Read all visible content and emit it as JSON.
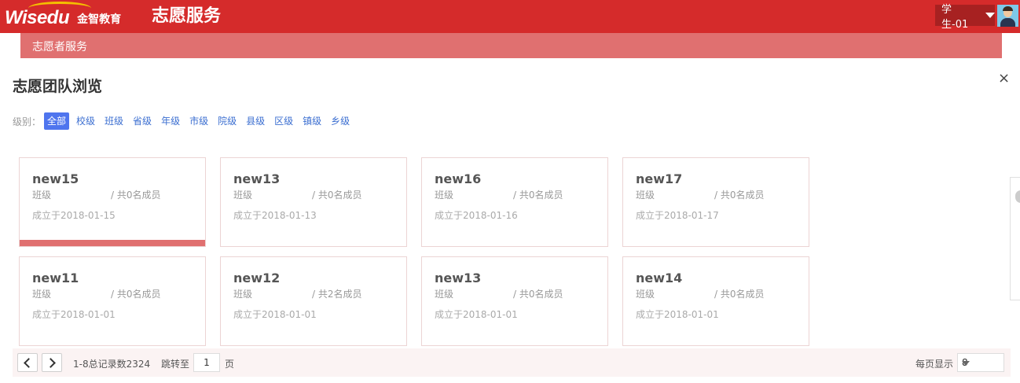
{
  "header": {
    "logo_en": "Wisedu",
    "logo_cn": "金智教育",
    "app_title": "志愿服务",
    "user_label": "学生-01"
  },
  "subnav": {
    "label": "志愿者服务"
  },
  "page": {
    "title": "志愿团队浏览",
    "close": "×"
  },
  "filter": {
    "label": "级别：",
    "levels": [
      "全部",
      "校级",
      "班级",
      "省级",
      "年级",
      "市级",
      "院级",
      "县级",
      "区级",
      "镇级",
      "乡级"
    ],
    "active": "全部"
  },
  "teams": [
    {
      "name": "new15",
      "type": "班级",
      "members": "/ 共0名成员",
      "date": "成立于2018-01-15"
    },
    {
      "name": "new13",
      "type": "班级",
      "members": "/ 共0名成员",
      "date": "成立于2018-01-13"
    },
    {
      "name": "new16",
      "type": "班级",
      "members": "/ 共0名成员",
      "date": "成立于2018-01-16"
    },
    {
      "name": "new17",
      "type": "班级",
      "members": "/ 共0名成员",
      "date": "成立于2018-01-17"
    },
    {
      "name": "new11",
      "type": "班级",
      "members": "/ 共0名成员",
      "date": "成立于2018-01-01"
    },
    {
      "name": "new12",
      "type": "班级",
      "members": "/ 共2名成员",
      "date": "成立于2018-01-01"
    },
    {
      "name": "new13",
      "type": "班级",
      "members": "/ 共0名成员",
      "date": "成立于2018-01-01"
    },
    {
      "name": "new14",
      "type": "班级",
      "members": "/ 共0名成员",
      "date": "成立于2018-01-01"
    }
  ],
  "pagination": {
    "range_text": "1-8总记录数2324",
    "jump_label": "跳转至",
    "jump_value": "1",
    "page_unit": "页",
    "per_page_label": "每页显示",
    "per_page_value": "8"
  },
  "colors": {
    "header_red": "#d52b2b",
    "subnav_pink": "#e07070",
    "active_level": "#4f75ee",
    "link_blue": "#3c6fd1"
  }
}
